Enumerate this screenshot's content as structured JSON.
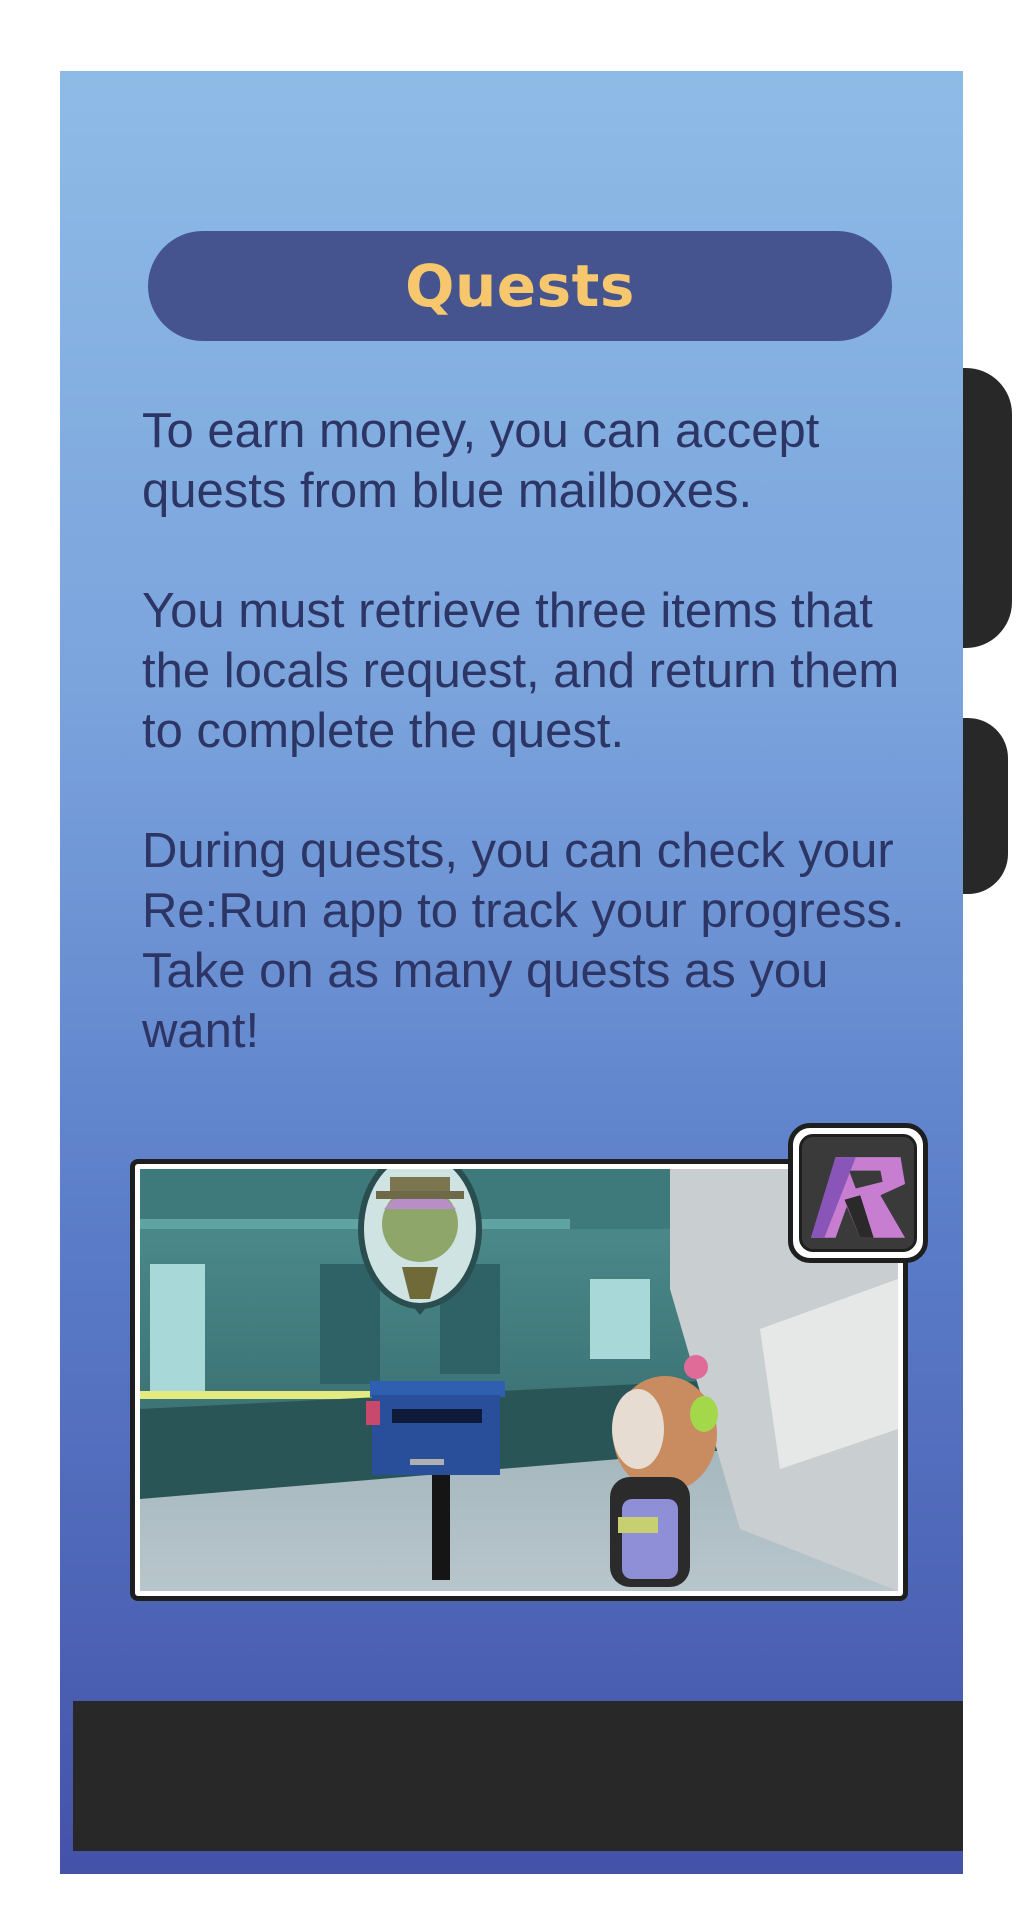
{
  "title": "Quests",
  "paragraphs": [
    "To earn money, you can accept quests from blue mailboxes.",
    "You must retrieve three items that the locals request, and return them to complete the quest.",
    "During quests, you can check your Re:Run app to track your progress. Take on as many quests as you want!"
  ],
  "colors": {
    "title_text": "#f6c76c",
    "title_pill": "#45538f",
    "body_text": "#2d3565",
    "panel_top": "#8ebbe6",
    "panel_bottom": "#4452a8"
  },
  "icons": {
    "app_logo": "rerun-app-logo-icon"
  }
}
